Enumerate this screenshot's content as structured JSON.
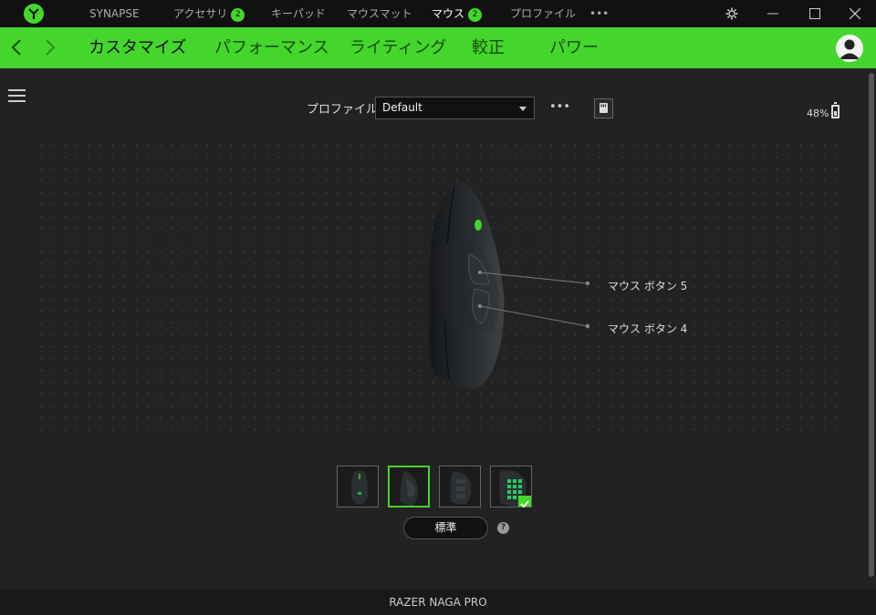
{
  "titlebar": {
    "tabs": [
      {
        "label": "SYNAPSE",
        "badge": null
      },
      {
        "label": "アクセサリ",
        "badge": "2"
      },
      {
        "label": "キーパッド",
        "badge": null
      },
      {
        "label": "マウスマット",
        "badge": null
      },
      {
        "label": "マウス",
        "badge": "2",
        "active": true
      },
      {
        "label": "プロファイル",
        "badge": null
      }
    ],
    "more": "•••",
    "icons": [
      "razer-logo-icon",
      "settings-icon",
      "minimize-icon",
      "maximize-icon",
      "close-icon"
    ]
  },
  "nav": {
    "tabs": [
      {
        "label": "カスタマイズ",
        "active": true
      },
      {
        "label": "パフォーマンス"
      },
      {
        "label": "ライティング"
      },
      {
        "label": "較正"
      },
      {
        "label": "パワー"
      }
    ],
    "icons": [
      "back-arrow-icon",
      "forward-arrow-icon",
      "account-icon"
    ]
  },
  "profile": {
    "label": "プロファイル",
    "selected": "Default",
    "more": "•••"
  },
  "battery": {
    "text": "48%",
    "level": 0.48
  },
  "callouts": {
    "button5": "マウス ボタン 5",
    "button4": "マウス ボタン 4"
  },
  "views": {
    "count": 4,
    "selected_index": 1,
    "checked_index": 3
  },
  "standard_button": "標準",
  "help": "?",
  "device_name": "RAZER NAGA PRO",
  "colors": {
    "accent": "#44d62c",
    "background": "#222222",
    "titlebar": "#111111"
  }
}
